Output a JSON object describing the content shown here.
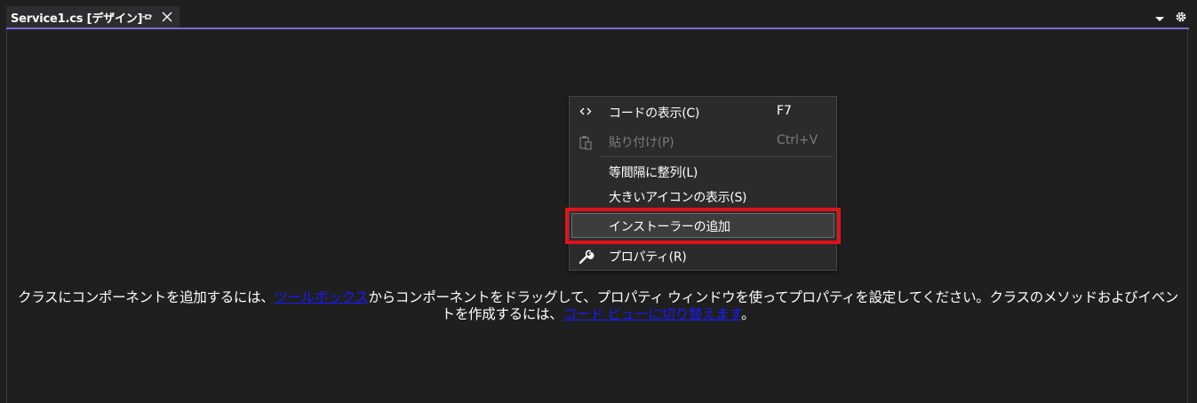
{
  "tab": {
    "title": "Service1.cs [デザイン]"
  },
  "menu": {
    "items": [
      {
        "label": "コードの表示(C)",
        "shortcut": "F7",
        "icon": "code-icon",
        "enabled": true
      },
      {
        "label": "貼り付け(P)",
        "shortcut": "Ctrl+V",
        "icon": "paste-icon",
        "enabled": false
      },
      {
        "label": "等間隔に整列(L)",
        "shortcut": "",
        "icon": "",
        "enabled": true
      },
      {
        "label": "大きいアイコンの表示(S)",
        "shortcut": "",
        "icon": "",
        "enabled": true
      },
      {
        "label": "インストーラーの追加",
        "shortcut": "",
        "icon": "",
        "enabled": true,
        "highlighted": true
      },
      {
        "label": "プロパティ(R)",
        "shortcut": "",
        "icon": "wrench-icon",
        "enabled": true
      }
    ]
  },
  "hint": {
    "part1": "クラスにコンポーネントを追加するには、",
    "link1": "ツールボックス",
    "part2": "からコンポーネントをドラッグして、プロパティ ウィンドウを使ってプロパティを設定してください。クラスのメソッドおよびイベントを作成するには、",
    "link2": "コード ビューに切り替えます",
    "part3": "。"
  },
  "colors": {
    "accent": "#7b6bd6",
    "highlight_box": "#e0121b",
    "link": "#1a1aff"
  }
}
